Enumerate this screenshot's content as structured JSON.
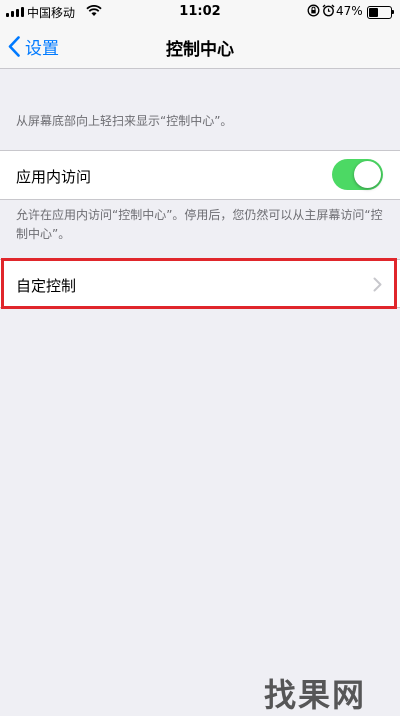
{
  "status_bar": {
    "carrier": "中国移动",
    "time": "11:02",
    "battery_percent": "47%",
    "battery_level": 0.47,
    "icons": [
      "signal-icon",
      "wifi-icon",
      "rotation-lock-icon",
      "alarm-icon",
      "battery-icon"
    ]
  },
  "nav_bar": {
    "back_label": "设置",
    "title": "控制中心"
  },
  "content": {
    "header_note": "从屏幕底部向上轻扫来显示“控制中心”。",
    "in_app_access": {
      "label": "应用内访问",
      "toggle_on": true
    },
    "footer_note": "允许在应用内访问“控制中心”。停用后，您仍然可以从主屏幕访问“控制中心”。",
    "customize": {
      "label": "自定控制"
    }
  },
  "highlight_color": "#e0262b",
  "accent_color": "#007aff",
  "toggle_color": "#4cd964",
  "watermark": "找果网"
}
